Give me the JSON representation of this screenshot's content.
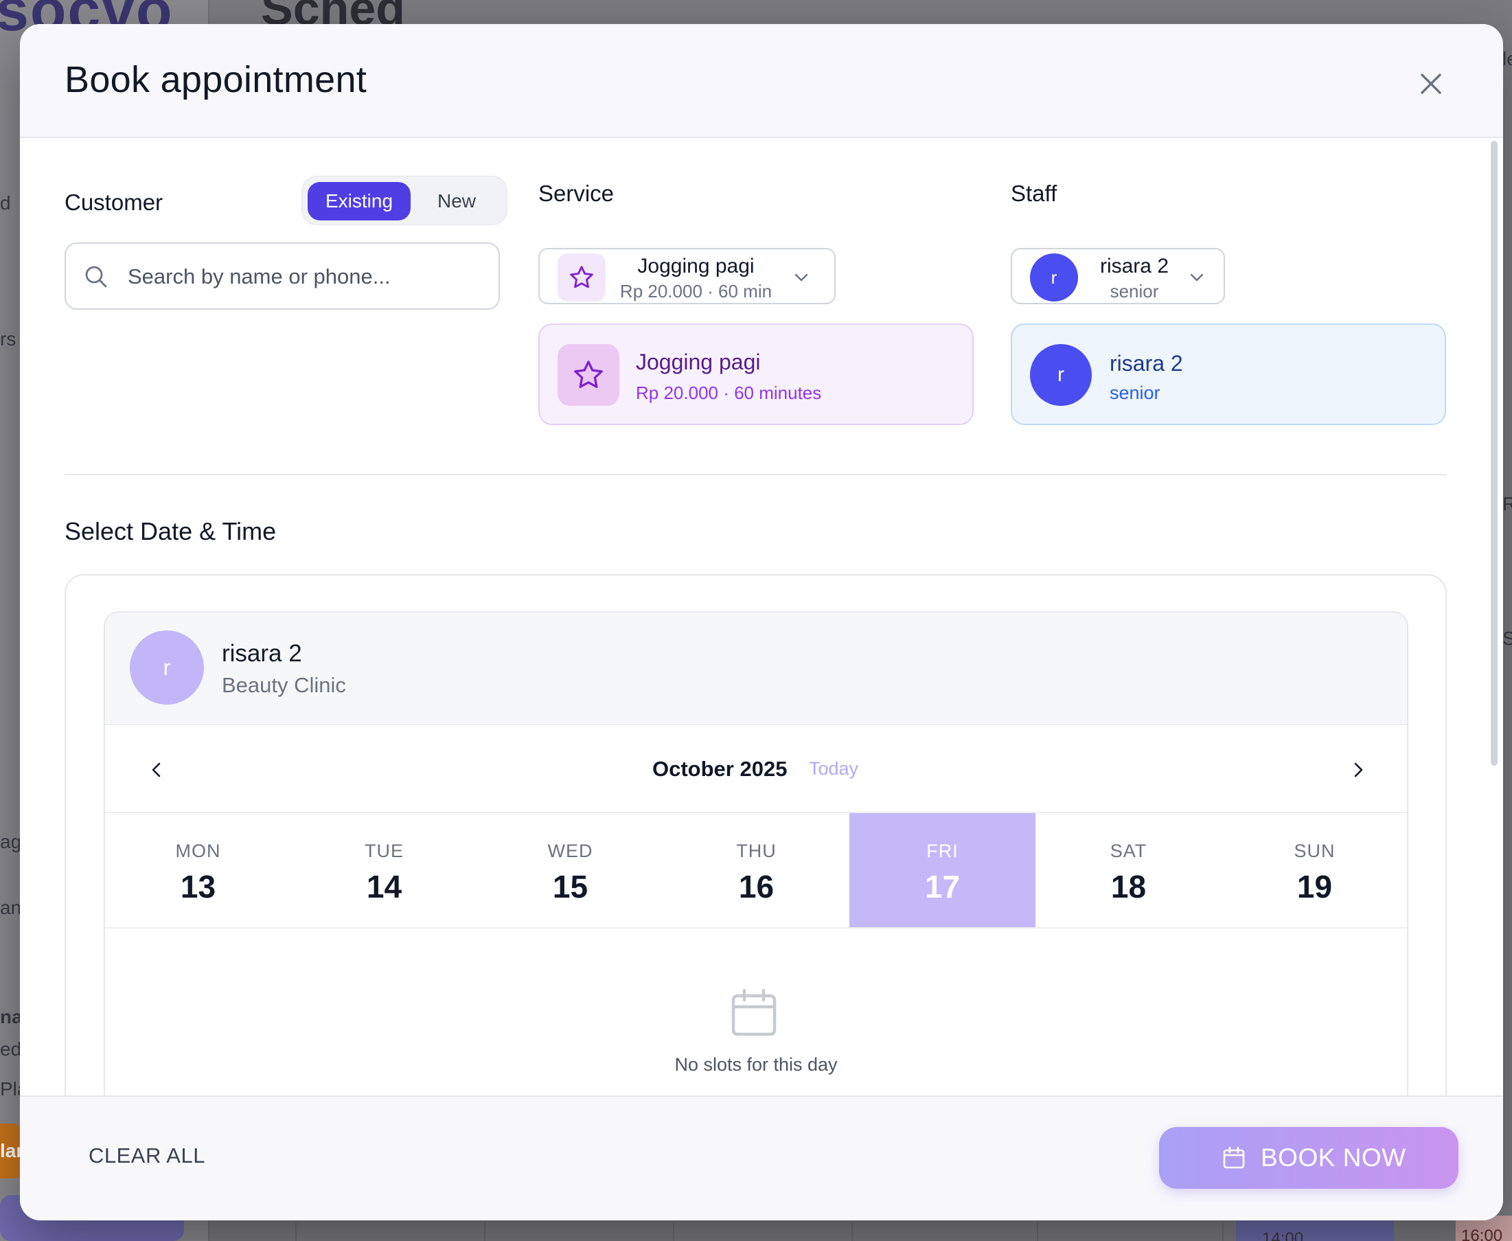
{
  "background": {
    "logo_fragment": "socvo",
    "title_fragment": "Sched",
    "right_fragments": [
      "le",
      "R",
      "S"
    ],
    "left_fragments": [
      "d",
      "rs",
      "ag",
      "an",
      "na",
      "ed",
      "Pla",
      "lar"
    ],
    "time_fragments": [
      "14:00",
      "16:00"
    ]
  },
  "modal": {
    "title": "Book appointment",
    "close_icon": "close-icon"
  },
  "customer": {
    "label": "Customer",
    "toggle": {
      "existing": "Existing",
      "new": "New",
      "selected": "existing"
    },
    "search_placeholder": "Search by name or phone...",
    "search_value": ""
  },
  "service": {
    "label": "Service",
    "selected_name": "Jogging pagi",
    "selected_meta": "Rp 20.000 · 60 min",
    "card_name": "Jogging pagi",
    "card_meta": "Rp 20.000 · 60 minutes",
    "icon": "star-icon"
  },
  "staff": {
    "label": "Staff",
    "avatar_initial": "r",
    "selected_name": "risara 2",
    "selected_role": "senior",
    "card_name": "risara 2",
    "card_role": "senior"
  },
  "datetime": {
    "section_title": "Select Date & Time",
    "staff_name": "risara 2",
    "staff_location": "Beauty Clinic",
    "staff_initial": "r",
    "month_label": "October 2025",
    "today_label": "Today",
    "days": [
      {
        "name": "MON",
        "num": "13",
        "selected": false
      },
      {
        "name": "TUE",
        "num": "14",
        "selected": false
      },
      {
        "name": "WED",
        "num": "15",
        "selected": false
      },
      {
        "name": "THU",
        "num": "16",
        "selected": false
      },
      {
        "name": "FRI",
        "num": "17",
        "selected": true
      },
      {
        "name": "SAT",
        "num": "18",
        "selected": false
      },
      {
        "name": "SUN",
        "num": "19",
        "selected": false
      }
    ],
    "empty_message": "No slots for this day"
  },
  "footer": {
    "clear_label": "CLEAR ALL",
    "book_label": "BOOK NOW"
  },
  "colors": {
    "primary": "#4f3ee3",
    "selected_day": "#c4b8f9",
    "book_gradient_start": "#a9a0f5",
    "book_gradient_end": "#c995ef"
  }
}
